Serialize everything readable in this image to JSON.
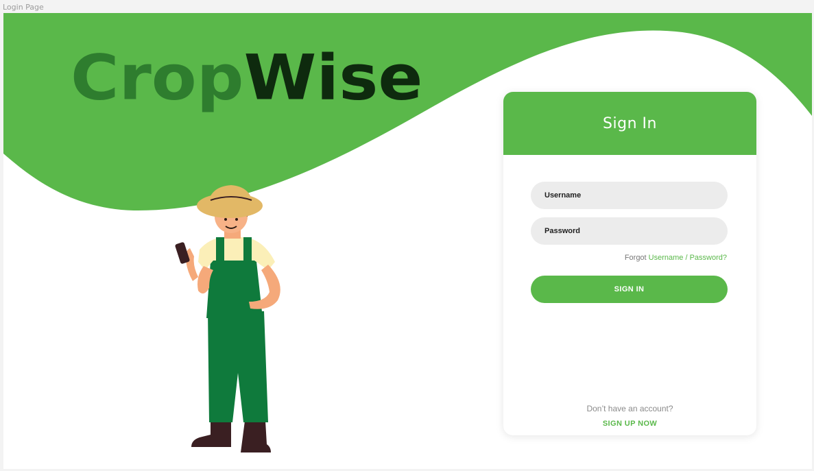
{
  "window": {
    "title": "Login Page"
  },
  "brand": {
    "logo_part1": "Crop",
    "logo_part2": "Wise",
    "logo_part1_color": "#2e7d2e",
    "logo_part2_color": "#0e2a0e"
  },
  "colors": {
    "accent": "#5ab84a",
    "background_wave": "#5ab84a",
    "overalls": "#0f7a3c",
    "hat": "#e2b866"
  },
  "illustration": {
    "icon": "farmer-with-phone"
  },
  "login": {
    "title": "Sign In",
    "username_placeholder": "Username",
    "password_placeholder": "Password",
    "forgot_prefix": "Forgot",
    "forgot_link": "Username / Password?",
    "signin_button": "SIGN IN",
    "no_account_text": "Don’t have an account?",
    "signup_link": "SIGN UP NOW"
  }
}
